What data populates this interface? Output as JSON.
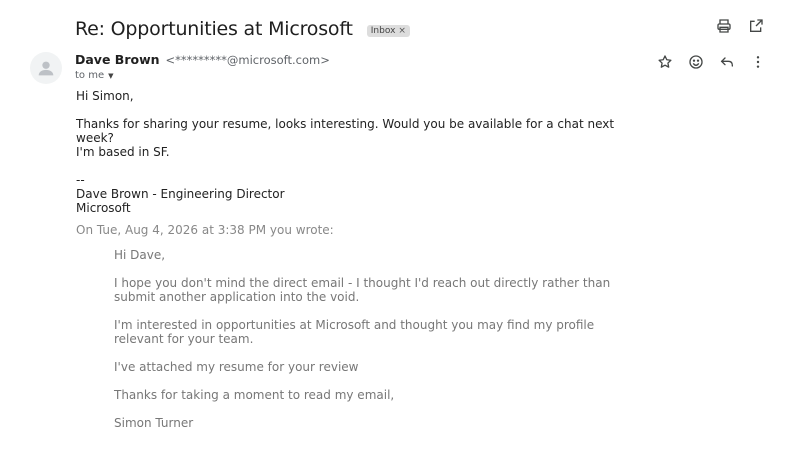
{
  "header": {
    "subject": "Re: Opportunities at Microsoft",
    "label": "Inbox",
    "label_remove": "×",
    "actions": [
      {
        "name": "print-icon"
      },
      {
        "name": "open-in-new-window-icon"
      }
    ]
  },
  "message": {
    "sender_name": "Dave Brown",
    "sender_email": "<*********@microsoft.com>",
    "to_label": "to me",
    "to_caret": "▼",
    "actions": [
      {
        "name": "star-icon"
      },
      {
        "name": "emoji-react-icon"
      },
      {
        "name": "reply-icon"
      },
      {
        "name": "more-options-icon"
      }
    ],
    "body": {
      "greeting": "Hi Simon,",
      "line1": "Thanks for sharing your resume, looks interesting. Would you be available for a chat next week?",
      "line2": "I'm based in SF.",
      "sig_sep": "--",
      "sig_name": "Dave Brown - Engineering Director",
      "sig_company": "Microsoft"
    }
  },
  "quoted": {
    "header": "On Tue, Aug 4, 2026 at 3:38 PM you wrote:",
    "greeting": "Hi Dave,",
    "para1": "I hope you don't mind the direct email - I thought I'd reach out directly rather than submit another application into the void.",
    "para2": "I'm interested in opportunities at Microsoft and thought you may find my profile relevant for your team.",
    "para3": "I've attached my resume for your review",
    "para4": "Thanks for taking a moment to read my email,",
    "signature": "Simon Turner"
  },
  "colors": {
    "icon": "#444746",
    "chip_bg": "#dddddd",
    "quote_text": "#777777"
  }
}
